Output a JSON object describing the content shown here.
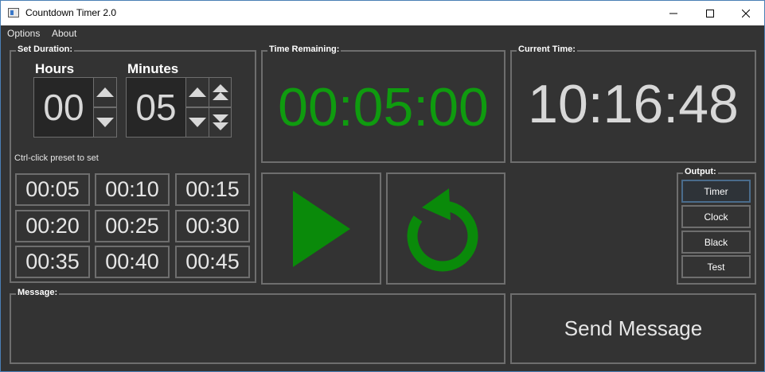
{
  "window": {
    "title": "Countdown Timer 2.0"
  },
  "menu": {
    "items": [
      "Options",
      "About"
    ]
  },
  "set_duration": {
    "label": "Set Duration:",
    "hours_label": "Hours",
    "minutes_label": "Minutes",
    "hours_value": "00",
    "minutes_value": "05",
    "hint": "Ctrl-click preset to set",
    "presets": [
      "00:05",
      "00:10",
      "00:15",
      "00:20",
      "00:25",
      "00:30",
      "00:35",
      "00:40",
      "00:45"
    ]
  },
  "time_remaining": {
    "label": "Time Remaining:",
    "value": "00:05:00"
  },
  "current_time": {
    "label": "Current Time:",
    "value": "10:16:48"
  },
  "output": {
    "label": "Output:",
    "options": [
      "Timer",
      "Clock",
      "Black",
      "Test"
    ],
    "selected": "Timer"
  },
  "message": {
    "label": "Message:",
    "value": ""
  },
  "send_button": {
    "label": "Send Message"
  },
  "controls": {
    "play_icon": "play-icon",
    "reset_icon": "reset-icon"
  },
  "colors": {
    "accent_green": "#0f9b0f",
    "background": "#333333",
    "border": "#6e6e6e"
  }
}
